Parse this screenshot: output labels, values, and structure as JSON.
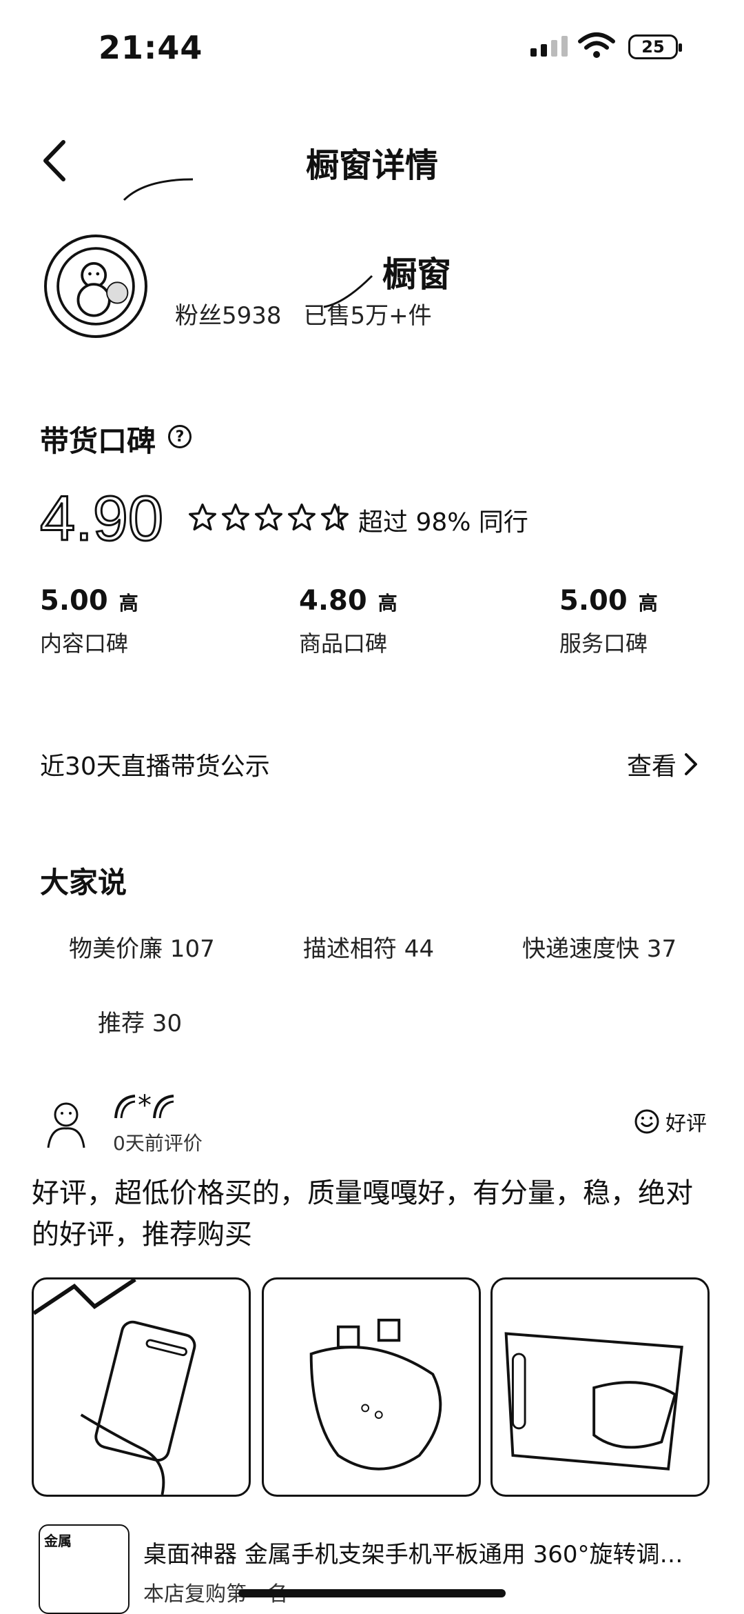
{
  "status_bar": {
    "time": "21:44",
    "battery": "25"
  },
  "header": {
    "title": "橱窗详情"
  },
  "shop": {
    "name": "橱窗",
    "fans": "粉丝5938",
    "sold": "已售5万+件"
  },
  "reputation": {
    "title": "带货口碑",
    "help_icon": "?",
    "score": "4.90",
    "stars": 4.9,
    "beat": "超过 98% 同行",
    "metrics": [
      {
        "value": "5.00",
        "level": "高",
        "label": "内容口碑"
      },
      {
        "value": "4.80",
        "level": "高",
        "label": "商品口碑"
      },
      {
        "value": "5.00",
        "level": "高",
        "label": "服务口碑"
      }
    ]
  },
  "live": {
    "label": "近30天直播带货公示",
    "action": "查看"
  },
  "everyone_says": {
    "title": "大家说",
    "tags": [
      "物美价廉 107",
      "描述相符 44",
      "快递速度快 37",
      "推荐 30"
    ]
  },
  "review": {
    "user": "*",
    "time": "0天前评价",
    "badge": "好评",
    "text": "好评，超低价格买的，质量嘎嘎好，有分量，稳，绝对的好评，推荐购买"
  },
  "product": {
    "title": "桌面神器 金属手机支架手机平板通用 360°旋转调…",
    "subtitle": "本店复购第一名",
    "image_text": "金属"
  }
}
